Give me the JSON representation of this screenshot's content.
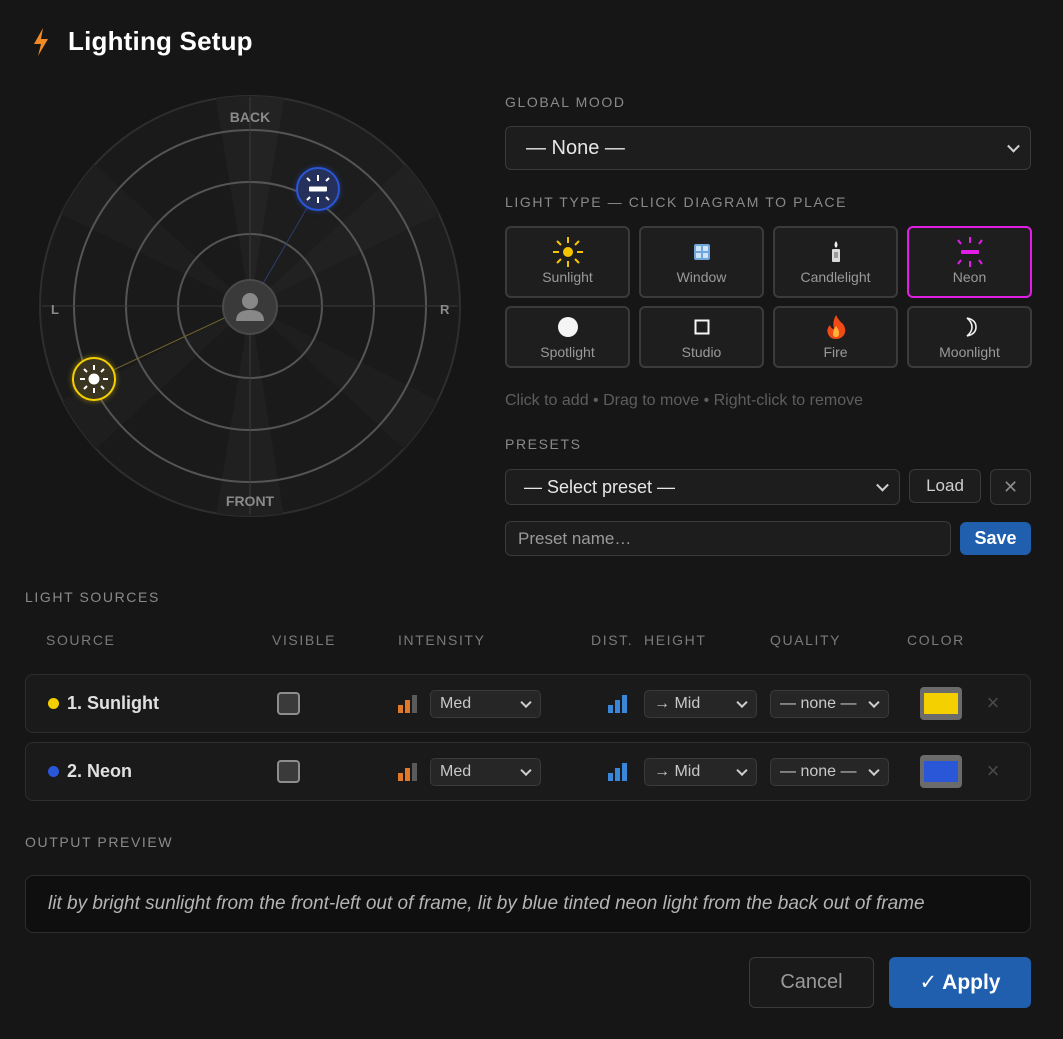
{
  "header": {
    "title": "Lighting Setup",
    "icon": "bolt-icon",
    "icon_color": "#f08a24"
  },
  "diagram": {
    "labels": {
      "back": "BACK",
      "front": "FRONT",
      "left": "L",
      "right": "R"
    },
    "lights": [
      {
        "name": "Sunlight",
        "color": "#f5d000",
        "icon": "sun-icon"
      },
      {
        "name": "Neon",
        "color": "#2a56d8",
        "icon": "neon-icon"
      }
    ]
  },
  "global_mood": {
    "label": "GLOBAL MOOD",
    "value": "— None —"
  },
  "light_type": {
    "label": "LIGHT TYPE — CLICK DIAGRAM TO PLACE",
    "types": [
      {
        "label": "Sunlight",
        "icon": "sun-icon"
      },
      {
        "label": "Window",
        "icon": "window-icon"
      },
      {
        "label": "Candlelight",
        "icon": "candle-icon"
      },
      {
        "label": "Neon",
        "icon": "neon-icon",
        "active": true
      },
      {
        "label": "Spotlight",
        "icon": "spotlight-icon"
      },
      {
        "label": "Studio",
        "icon": "studio-icon"
      },
      {
        "label": "Fire",
        "icon": "fire-icon"
      },
      {
        "label": "Moonlight",
        "icon": "moon-icon"
      }
    ],
    "hint": "Click to add • Drag to move • Right-click to remove",
    "active_color": "#e21ee6"
  },
  "presets": {
    "label": "PRESETS",
    "select_value": "— Select preset —",
    "load_label": "Load",
    "clear_label": "✕",
    "name_placeholder": "Preset name…",
    "save_label": "Save"
  },
  "sources": {
    "label": "LIGHT SOURCES",
    "columns": [
      "SOURCE",
      "VISIBLE",
      "INTENSITY",
      "DIST.",
      "HEIGHT",
      "QUALITY",
      "COLOR"
    ],
    "rows": [
      {
        "name": "1. Sunlight",
        "dot_color": "#f5d000",
        "visible": false,
        "intensity": "Med",
        "height": "→ Mid",
        "quality": "— none —",
        "color": "#f5d000"
      },
      {
        "name": "2. Neon",
        "dot_color": "#2a56d8",
        "visible": false,
        "intensity": "Med",
        "height": "→ Mid",
        "quality": "— none —",
        "color": "#2a56d8"
      }
    ]
  },
  "output": {
    "label": "OUTPUT PREVIEW",
    "text": "lit by bright sunlight from the front-left out of frame, lit by blue tinted neon light from the back out of frame"
  },
  "footer": {
    "cancel_label": "Cancel",
    "apply_label": "✓ Apply"
  }
}
